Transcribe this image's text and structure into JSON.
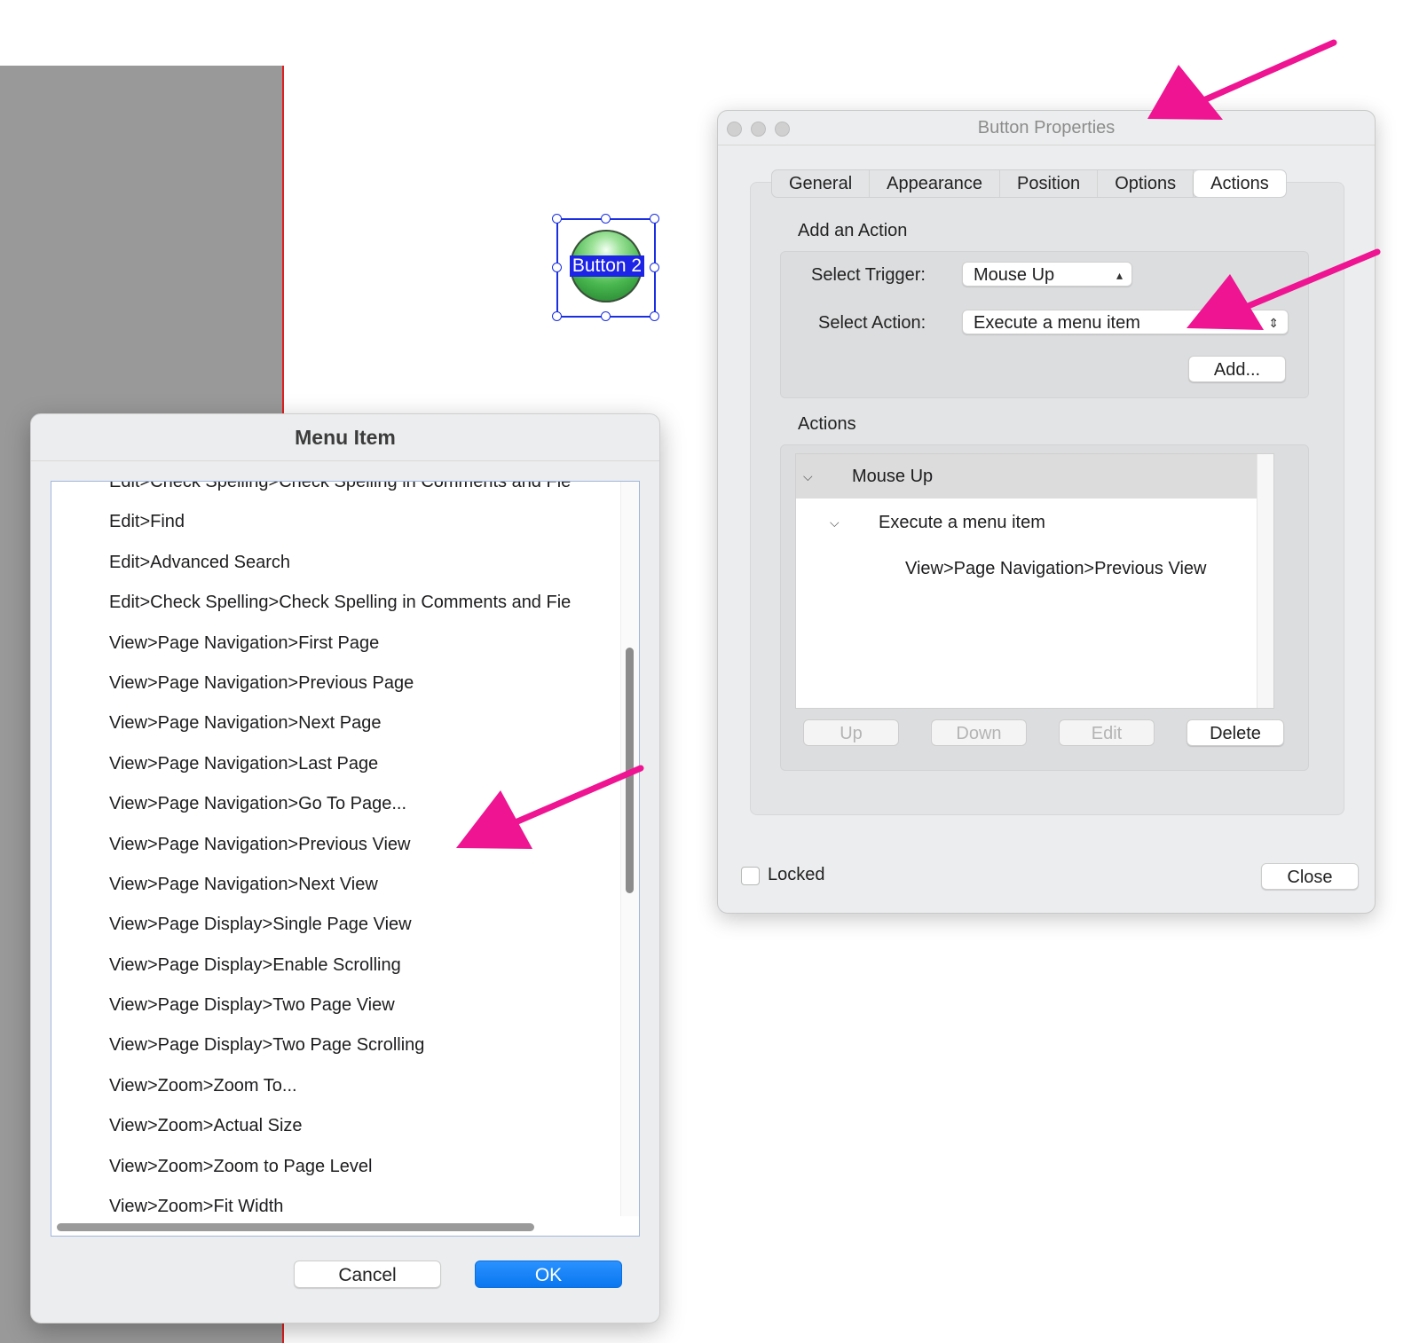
{
  "colors": {
    "accent": "#0a77f0",
    "annotation_arrow": "#ee1492",
    "selection": "#1a2fe0",
    "page_margin": "#999999"
  },
  "form_button": {
    "label": "Button 2"
  },
  "button_properties": {
    "title": "Button Properties",
    "tabs": [
      {
        "label": "General"
      },
      {
        "label": "Appearance"
      },
      {
        "label": "Position"
      },
      {
        "label": "Options"
      },
      {
        "label": "Actions",
        "selected": true
      }
    ],
    "add_action": {
      "heading": "Add an Action",
      "trigger_label": "Select Trigger:",
      "trigger_value": "Mouse Up",
      "action_label": "Select Action:",
      "action_value": "Execute a menu item",
      "add_button": "Add..."
    },
    "actions": {
      "heading": "Actions",
      "tree": [
        {
          "label": "Mouse Up",
          "level": 0,
          "expanded": true,
          "selected": true
        },
        {
          "label": "Execute a menu item",
          "level": 1,
          "expanded": true
        },
        {
          "label": "View>Page Navigation>Previous View",
          "level": 2
        }
      ],
      "buttons": {
        "up": "Up",
        "down": "Down",
        "edit": "Edit",
        "delete": "Delete"
      }
    },
    "locked_label": "Locked",
    "locked_checked": false,
    "close_button": "Close"
  },
  "menu_item_dialog": {
    "title": "Menu Item",
    "items": [
      "Edit>Check Spelling>Check Spelling in Comments and Fie",
      "Edit>Find",
      "Edit>Advanced Search",
      "Edit>Check Spelling>Check Spelling in Comments and Fie",
      "View>Page Navigation>First Page",
      "View>Page Navigation>Previous Page",
      "View>Page Navigation>Next Page",
      "View>Page Navigation>Last Page",
      "View>Page Navigation>Go To Page...",
      "View>Page Navigation>Previous View",
      "View>Page Navigation>Next View",
      "View>Page Display>Single Page View",
      "View>Page Display>Enable Scrolling",
      "View>Page Display>Two Page View",
      "View>Page Display>Two Page Scrolling",
      "View>Zoom>Zoom To...",
      "View>Zoom>Actual Size",
      "View>Zoom>Zoom to Page Level",
      "View>Zoom>Fit Width"
    ],
    "cancel_button": "Cancel",
    "ok_button": "OK"
  }
}
